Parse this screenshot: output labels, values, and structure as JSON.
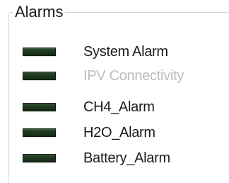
{
  "group": {
    "title": "Alarms"
  },
  "alarms": [
    {
      "label": "System Alarm",
      "state": "off",
      "enabled": true
    },
    {
      "label": "IPV Connectivity",
      "state": "off",
      "enabled": false
    },
    {
      "label": "CH4_Alarm",
      "state": "off",
      "enabled": true
    },
    {
      "label": "H2O_Alarm",
      "state": "off",
      "enabled": true
    },
    {
      "label": "Battery_Alarm",
      "state": "off",
      "enabled": true
    }
  ],
  "colors": {
    "led_off": "#1f3a1f",
    "text": "#1a1a1a",
    "text_disabled": "#bdbdbd",
    "group_border": "#d5d5d5"
  }
}
